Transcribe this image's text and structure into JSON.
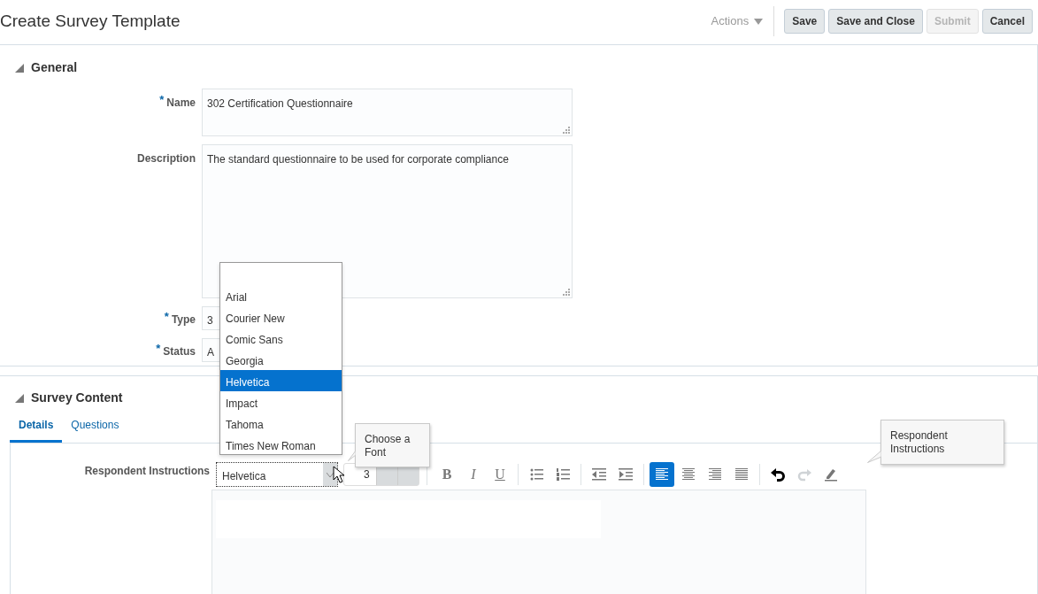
{
  "page_title": "Create Survey Template",
  "header": {
    "actions": {
      "label": "Actions",
      "disabled": true
    },
    "buttons": [
      {
        "label": "Save",
        "disabled": false
      },
      {
        "label": "Save and Close",
        "disabled": false
      },
      {
        "label": "Submit",
        "disabled": true
      },
      {
        "label": "Cancel",
        "disabled": false
      }
    ]
  },
  "general": {
    "title": "General",
    "expanded": true,
    "fields": [
      {
        "label": "Name",
        "required_mark": "*",
        "kind": "textarea",
        "value": "302 Certification Questionnaire"
      },
      {
        "label": "Description",
        "kind": "textarea-tall",
        "value": "The standard questionnaire to be used for corporate compliance"
      },
      {
        "label": "Type",
        "required_mark": "*",
        "kind": "select",
        "value": "3"
      },
      {
        "label": "Status",
        "required_mark": "*",
        "kind": "select",
        "value": "A"
      }
    ]
  },
  "survey_content": {
    "title": "Survey Content",
    "expanded": true,
    "tabs": [
      {
        "label": "Details",
        "selected": true
      },
      {
        "label": "Questions",
        "selected": false
      }
    ],
    "instructions_label": "Respondent Instructions",
    "font_select": {
      "value": "Helvetica",
      "expanded": true
    },
    "font_options": [
      {
        "label": "Arial",
        "selected": false
      },
      {
        "label": "Courier New",
        "selected": false
      },
      {
        "label": "Comic Sans",
        "selected": false
      },
      {
        "label": "Georgia",
        "selected": false
      },
      {
        "label": "Helvetica",
        "selected": true
      },
      {
        "label": "Impact",
        "selected": false
      },
      {
        "label": "Tahoma",
        "selected": false
      },
      {
        "label": "Times New Roman",
        "selected": false
      }
    ],
    "size_select": {
      "value": "3"
    },
    "toolbar": [
      {
        "kind": "bold",
        "label": "B",
        "selected": false,
        "disabled": false
      },
      {
        "kind": "italic",
        "label": "I",
        "selected": false,
        "disabled": false
      },
      {
        "kind": "underline",
        "label": "U",
        "selected": false,
        "disabled": false
      },
      {
        "kind": "separator"
      },
      {
        "kind": "bullets",
        "selected": false,
        "disabled": false
      },
      {
        "kind": "numbers",
        "selected": false,
        "disabled": false
      },
      {
        "kind": "separator"
      },
      {
        "kind": "outdent",
        "selected": false,
        "disabled": false
      },
      {
        "kind": "indent",
        "selected": false,
        "disabled": false
      },
      {
        "kind": "separator"
      },
      {
        "kind": "align-left",
        "selected": true,
        "disabled": false
      },
      {
        "kind": "align-center",
        "selected": false,
        "disabled": false
      },
      {
        "kind": "align-right",
        "selected": false,
        "disabled": false
      },
      {
        "kind": "justify",
        "selected": false,
        "disabled": false
      },
      {
        "kind": "separator"
      },
      {
        "kind": "undo",
        "selected": false,
        "disabled": false
      },
      {
        "kind": "redo",
        "selected": false,
        "disabled": true
      },
      {
        "kind": "eraser",
        "selected": false,
        "disabled": false
      }
    ],
    "tooltips": [
      {
        "text": "Choose a Font"
      },
      {
        "text": "Respondent Instructions"
      }
    ]
  }
}
